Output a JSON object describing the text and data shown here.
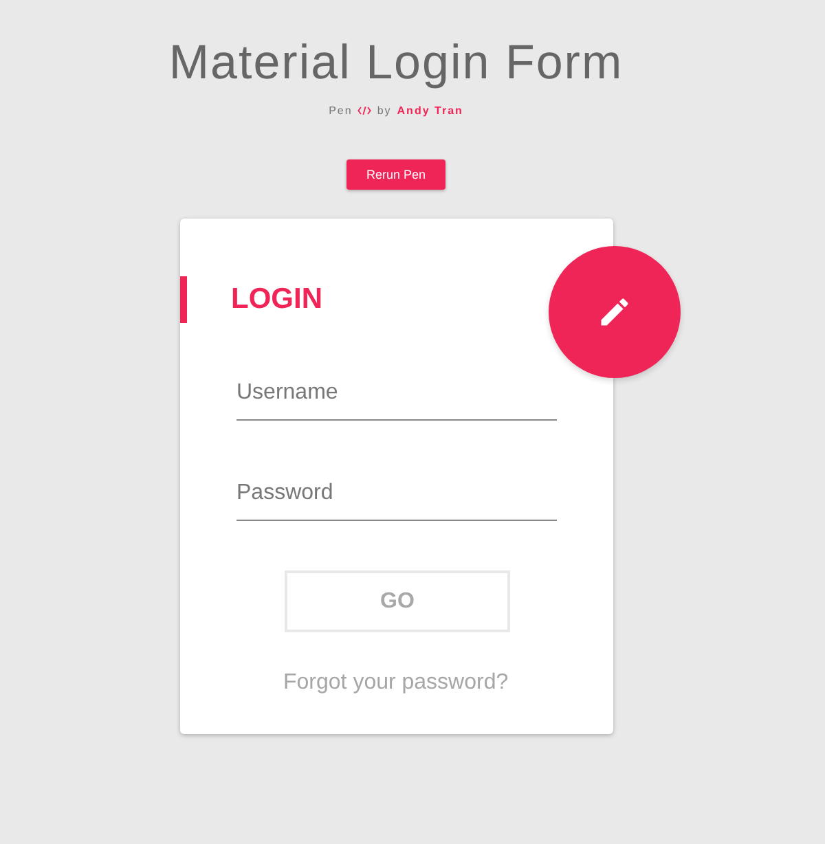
{
  "header": {
    "title": "Material Login Form",
    "credit_prefix": "Pen",
    "credit_by": "by",
    "author": "Andy Tran"
  },
  "rerun_button": "Rerun Pen",
  "card": {
    "title": "LOGIN",
    "fields": [
      {
        "placeholder": "Username"
      },
      {
        "placeholder": "Password"
      }
    ],
    "submit": {
      "label": "GO",
      "disabled": true
    },
    "forgot_link": "Forgot your password?"
  }
}
